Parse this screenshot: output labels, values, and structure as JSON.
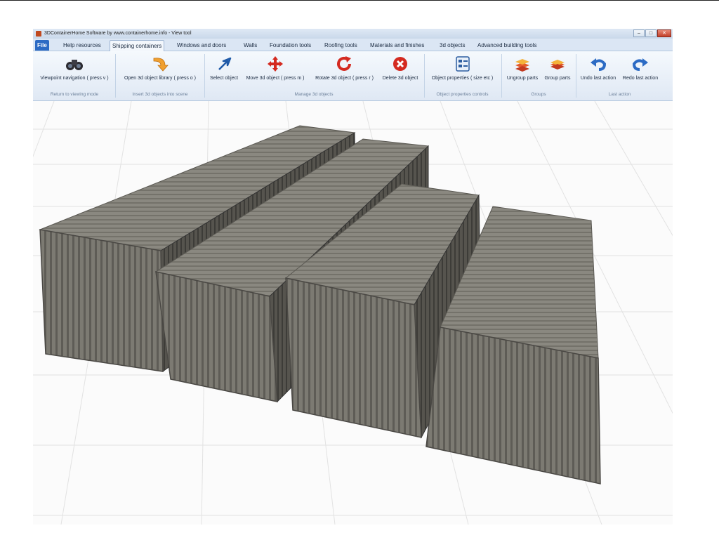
{
  "window": {
    "title": "3DContainerHome Software by www.containerhome.info - View tool",
    "min_glyph": "–",
    "max_glyph": "□",
    "close_glyph": "✕"
  },
  "menu": {
    "tabs": [
      {
        "label": "File"
      },
      {
        "label": "Help resources"
      },
      {
        "label": "Shipping containers"
      },
      {
        "label": "Windows and doors"
      },
      {
        "label": "Walls"
      },
      {
        "label": "Foundation tools"
      },
      {
        "label": "Roofing tools"
      },
      {
        "label": "Materials and finishes"
      },
      {
        "label": "3d objects"
      },
      {
        "label": "Advanced building tools"
      }
    ]
  },
  "ribbon": {
    "buttons": [
      {
        "label": "Viewpoint navigation ( press v )",
        "icon": "binoculars-icon"
      },
      {
        "label": "Open 3d object library ( press o )",
        "icon": "curved-arrow-icon"
      },
      {
        "label": "Select object",
        "icon": "select-arrow-icon"
      },
      {
        "label": "Move 3d object ( press m )",
        "icon": "move-arrows-icon"
      },
      {
        "label": "Rotate 3d object ( press r )",
        "icon": "rotate-icon"
      },
      {
        "label": "Delete 3d object",
        "icon": "delete-icon"
      },
      {
        "label": "Object properties ( size etc )",
        "icon": "properties-icon"
      },
      {
        "label": "Ungroup parts",
        "icon": "ungroup-icon"
      },
      {
        "label": "Group parts",
        "icon": "group-icon"
      },
      {
        "label": "Undo last action",
        "icon": "undo-icon"
      },
      {
        "label": "Redo last action",
        "icon": "redo-icon"
      }
    ],
    "groups": [
      {
        "label": "Return to viewing mode"
      },
      {
        "label": "Insert 3d objects into scene"
      },
      {
        "label": "Manage 3d objects"
      },
      {
        "label": "Object properties controls"
      },
      {
        "label": "Groups"
      },
      {
        "label": "Last action"
      }
    ]
  },
  "scene": {
    "content": "four shipping containers",
    "container_color": "#7a7870",
    "floor_color": "#f7f7f7"
  }
}
